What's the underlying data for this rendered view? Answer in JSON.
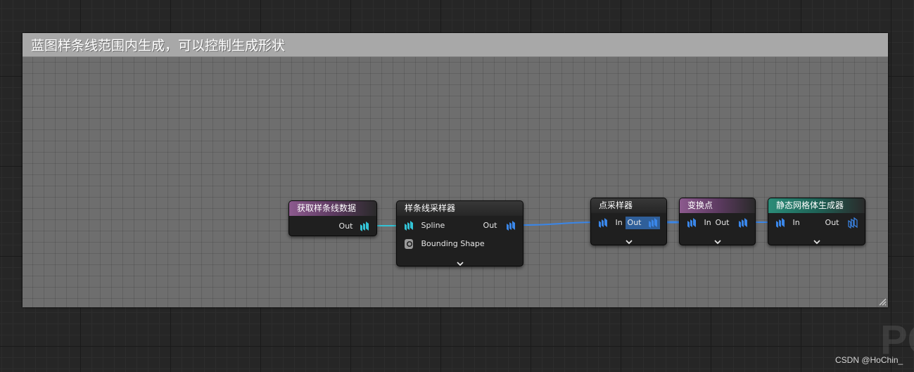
{
  "comment": {
    "title": "蓝图样条线范围内生成，可以控制生成形状"
  },
  "nodes": {
    "get_spline": {
      "title": "获取样条线数据",
      "out_label": "Out"
    },
    "spline_sampler": {
      "title": "样条线采样器",
      "pin_spline": "Spline",
      "pin_bounding": "Bounding Shape",
      "out_label": "Out"
    },
    "point_sampler": {
      "title": "点采样器",
      "in_label": "In",
      "out_label": "Out"
    },
    "transform_points": {
      "title": "变换点",
      "in_label": "In",
      "out_label": "Out"
    },
    "static_mesh_spawner": {
      "title": "静态网格体生成器",
      "in_label": "In",
      "out_label": "Out"
    }
  },
  "colors": {
    "spline_pin": "#33c3d6",
    "point_pin": "#3a86e8",
    "header_purple": "#8c5a8e",
    "header_teal": "#2b8c78"
  },
  "watermark": {
    "csdn": "CSDN @HoChin_",
    "pc": "PC"
  }
}
